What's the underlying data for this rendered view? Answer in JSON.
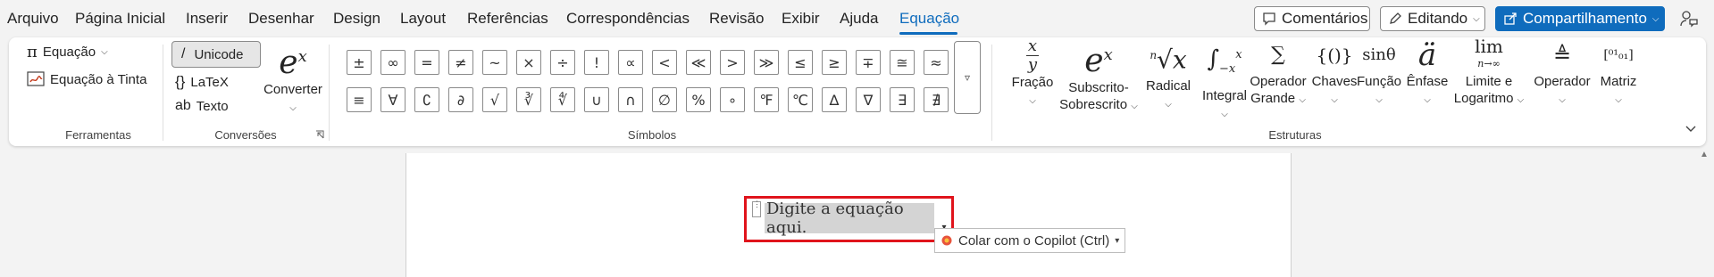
{
  "menu": {
    "tabs": [
      {
        "label": "Arquivo"
      },
      {
        "label": "Página Inicial"
      },
      {
        "label": "Inserir"
      },
      {
        "label": "Desenhar"
      },
      {
        "label": "Design"
      },
      {
        "label": "Layout"
      },
      {
        "label": "Referências"
      },
      {
        "label": "Correspondências"
      },
      {
        "label": "Revisão"
      },
      {
        "label": "Exibir"
      },
      {
        "label": "Ajuda"
      },
      {
        "label": "Equação"
      }
    ],
    "active_tab": "Equação",
    "comments_label": "Comentários",
    "editing_label": "Editando",
    "share_label": "Compartilhamento"
  },
  "ribbon": {
    "ferramentas": {
      "group_label": "Ferramentas",
      "equation_label": "Equação",
      "ink_equation_label": "Equação à Tinta"
    },
    "conversoes": {
      "group_label": "Conversões",
      "unicode_label": "Unicode",
      "latex_label": "LaTeX",
      "text_label": "Texto",
      "convert_label": "Converter"
    },
    "simbolos": {
      "group_label": "Símbolos",
      "row1": [
        "±",
        "∞",
        "=",
        "≠",
        "~",
        "×",
        "÷",
        "!",
        "∝",
        "<",
        "≪",
        ">",
        "≫",
        "≤",
        "≥",
        "∓",
        "≅",
        "≈"
      ],
      "row2": [
        "≡",
        "∀",
        "∁",
        "∂",
        "√",
        "∛",
        "∜",
        "∪",
        "∩",
        "∅",
        "%",
        "∘",
        "℉",
        "℃",
        "∆",
        "∇",
        "∃",
        "∄"
      ]
    },
    "estruturas": {
      "group_label": "Estruturas",
      "items": [
        {
          "line1": "Fração",
          "line2": ""
        },
        {
          "line1": "Subscrito-",
          "line2": "Sobrescrito"
        },
        {
          "line1": "Radical",
          "line2": ""
        },
        {
          "line1": "Integral",
          "line2": ""
        },
        {
          "line1": "Operador",
          "line2": "Grande"
        },
        {
          "line1": "Chaves",
          "line2": ""
        },
        {
          "line1": "Função",
          "line2": ""
        },
        {
          "line1": "Ênfase",
          "line2": ""
        },
        {
          "line1": "Limite e",
          "line2": "Logaritmo"
        },
        {
          "line1": "Operador",
          "line2": ""
        },
        {
          "line1": "Matriz",
          "line2": ""
        }
      ],
      "function_glyph": "sinθ",
      "limit_glyph_top": "lim",
      "limit_glyph_bottom": "n→∞"
    }
  },
  "document": {
    "equation_placeholder": "Digite a equação aqui.",
    "paste_label": "Colar com o Copilot (Ctrl)"
  },
  "colors": {
    "accent": "#0f6cbd",
    "highlight_border": "#e0141c"
  }
}
